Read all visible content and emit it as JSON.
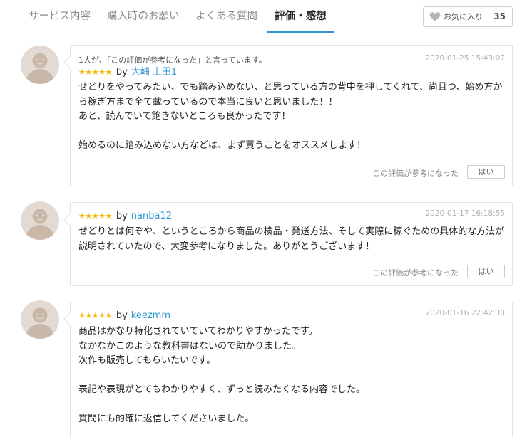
{
  "tabs": [
    {
      "label": "サービス内容"
    },
    {
      "label": "購入時のお願い"
    },
    {
      "label": "よくある質問"
    },
    {
      "label": "評価・感想",
      "active": true
    }
  ],
  "favorite": {
    "label": "お気に入り",
    "count": "35",
    "icon": "heart-icon"
  },
  "colors": {
    "accent": "#2f96d2",
    "star": "#f5b800",
    "avatar_bg": "#e3dbd3",
    "avatar_fg": "#c9b8a8"
  },
  "reviews": [
    {
      "helpful_note": "1人が、「この評価が参考になった」と言っています。",
      "stars": "★★★★★",
      "rating": 5,
      "by": "by",
      "author": "大輔 上田1",
      "date": "2020-01-25 15:43:07",
      "body": "せどりをやってみたい、でも踏み込めない、と思っている方の背中を押してくれて、尚且つ、始め方から稼ぎ方まで全て載っているので本当に良いと思いました！！\nあと、読んでいて飽きないところも良かったです！\n\n始めるのに踏み込めない方などは、まず買うことをオススメします！",
      "helpful_question": "この評価が参考になった",
      "yes_label": "はい"
    },
    {
      "helpful_note": "",
      "stars": "★★★★★",
      "rating": 5,
      "by": "by",
      "author": "nanba12",
      "date": "2020-01-17 16:18:55",
      "body": "せどりとは何ぞや、というところから商品の検品・発送方法、そして実際に稼ぐための具体的な方法が説明されていたので、大変参考になりました。ありがとうございます！",
      "helpful_question": "この評価が参考になった",
      "yes_label": "はい"
    },
    {
      "helpful_note": "",
      "stars": "★★★★★",
      "rating": 5,
      "by": "by",
      "author": "keezmm",
      "date": "2020-01-16 22:42:30",
      "body": "商品はかなり特化されていていてわかりやすかったです。\nなかなかこのような教科書はないので助かりました。\n次作も販売してもらいたいです。\n\n表記や表現がとてもわかりやすく、ずっと読みたくなる内容でした。\n\n質問にも的確に返信してくださいました。",
      "helpful_question": "",
      "yes_label": ""
    }
  ]
}
